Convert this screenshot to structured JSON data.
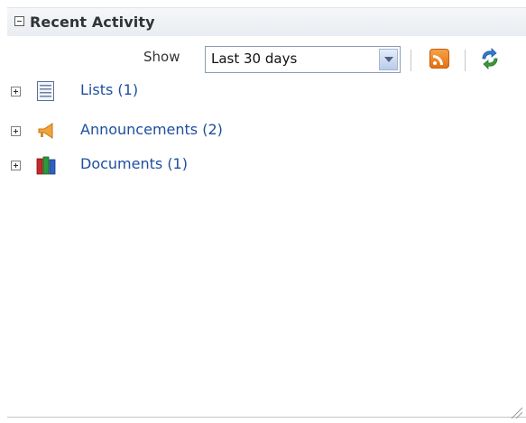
{
  "webpart": {
    "title": "Recent Activity"
  },
  "toolbar": {
    "show_label": "Show",
    "range_value": "Last 30 days",
    "rss_icon": "rss-feed-icon",
    "refresh_icon": "refresh-icon"
  },
  "tree": {
    "items": [
      {
        "label": "Lists (1)",
        "icon": "list-icon"
      },
      {
        "label": "Announcements (2)",
        "icon": "megaphone-icon"
      },
      {
        "label": "Documents (1)",
        "icon": "books-icon"
      }
    ]
  },
  "colors": {
    "link": "#1e4fa0",
    "header_bg": "#e9edf1",
    "rss": "#e36f12",
    "refresh": "#2f7bd0"
  }
}
